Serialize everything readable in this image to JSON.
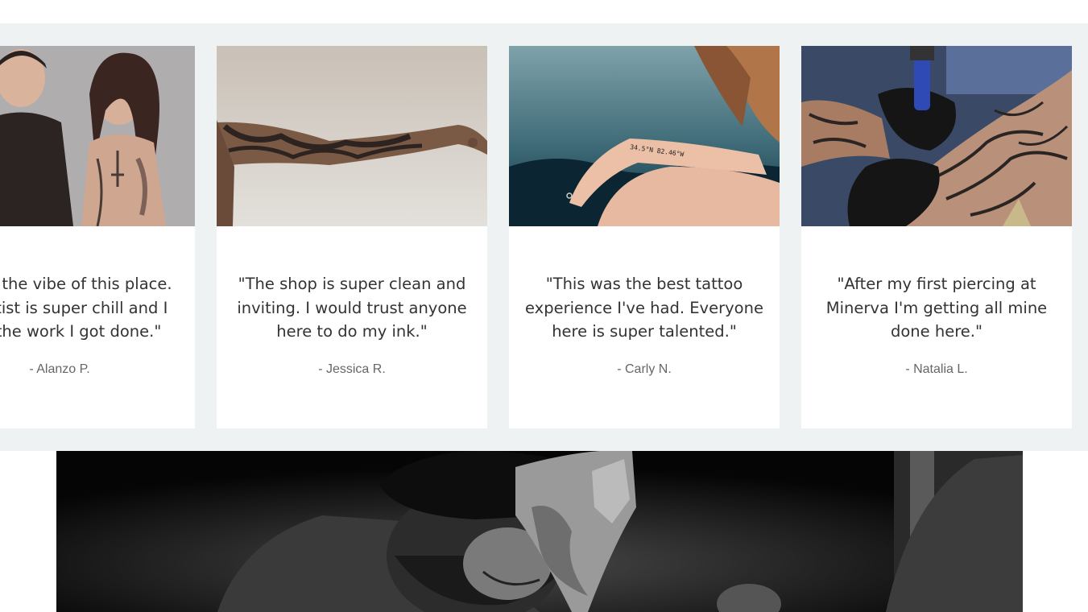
{
  "testimonials": [
    {
      "quote": "\"I love the vibe of this place. My artist is super chill and I love the work I got done.\"",
      "author": "- Alanzo P."
    },
    {
      "quote": "\"The shop is super clean and inviting. I would trust anyone here to do my ink.\"",
      "author": "- Jessica R."
    },
    {
      "quote": "\"This was the best tattoo experience I've had. Everyone here is super talented.\"",
      "author": "- Carly N."
    },
    {
      "quote": "\"After my first piercing at Minerva I'm getting all mine done here.\"",
      "author": "- Natalia L."
    }
  ],
  "photos": {
    "wrist_tattoo_text": "34.5°N 82.46°W"
  },
  "colors": {
    "section_bg": "#eef2f3",
    "card_bg": "#ffffff",
    "quote_text": "#333333",
    "author_text": "#666666"
  }
}
